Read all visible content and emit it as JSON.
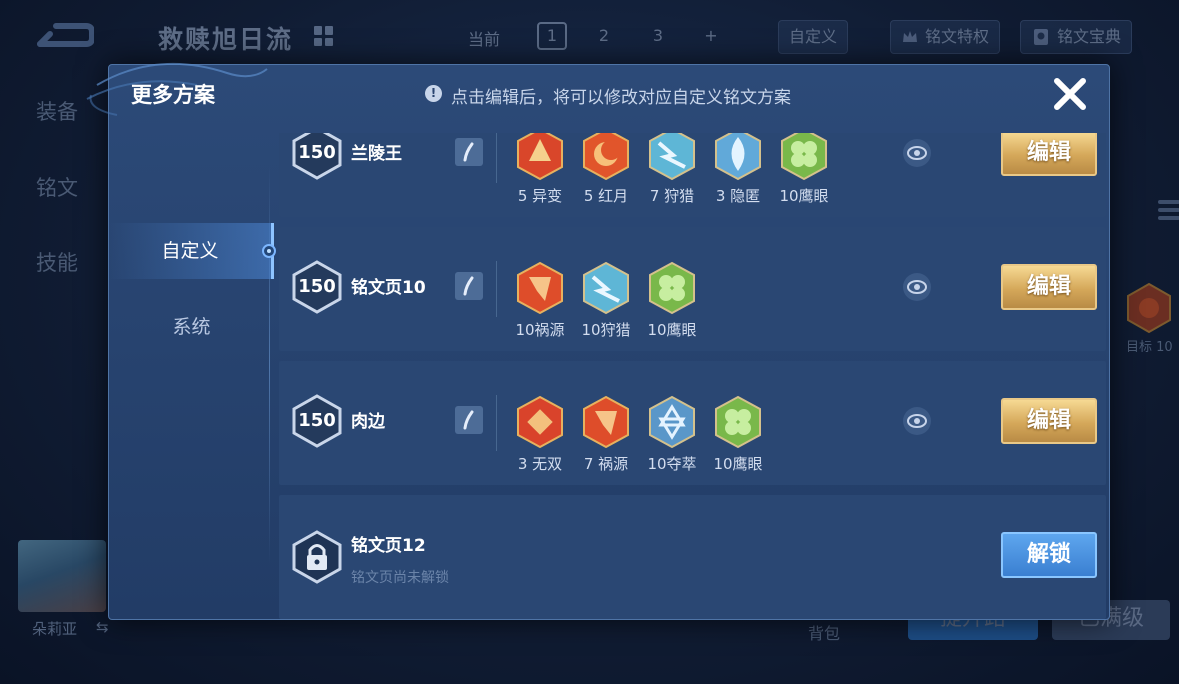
{
  "background": {
    "hero_title": "救赎旭日流",
    "current_label": "当前",
    "pages": [
      "1",
      "2",
      "3",
      "+"
    ],
    "custom_button": "自定义",
    "privilege_button": "铭文特权",
    "codex_button": "铭文宝典",
    "side_nav": [
      "装备",
      "铭文",
      "技能"
    ],
    "side_rune_label": "目标 10",
    "hero_name": "朵莉亚",
    "bag_label": "背包",
    "bottom_buttons": [
      "提升路",
      "已满级"
    ]
  },
  "modal": {
    "title": "更多方案",
    "hint": "点击编辑后，将可以修改对应自定义铭文方案",
    "tabs": [
      "自定义",
      "系统"
    ],
    "rows": [
      {
        "level": "150",
        "name": "兰陵王",
        "runes": [
          {
            "label": "5 异变",
            "color": "#d9462a"
          },
          {
            "label": "5 红月",
            "color": "#e1552b"
          },
          {
            "label": "7 狩猎",
            "color": "#5eb6d6"
          },
          {
            "label": "3 隐匿",
            "color": "#61a9d9"
          },
          {
            "label": "10鹰眼",
            "color": "#79b84a"
          }
        ],
        "action": "编辑"
      },
      {
        "level": "150",
        "name": "铭文页10",
        "runes": [
          {
            "label": "10祸源",
            "color": "#de4d2a"
          },
          {
            "label": "10狩猎",
            "color": "#5eb6d6"
          },
          {
            "label": "10鹰眼",
            "color": "#79b84a"
          }
        ],
        "action": "编辑"
      },
      {
        "level": "150",
        "name": "肉边",
        "runes": [
          {
            "label": "3 无双",
            "color": "#d9432b"
          },
          {
            "label": "7 祸源",
            "color": "#de4d2a"
          },
          {
            "label": "10夺萃",
            "color": "#5a97c9"
          },
          {
            "label": "10鹰眼",
            "color": "#79b84a"
          }
        ],
        "action": "编辑"
      }
    ],
    "locked_row": {
      "name": "铭文页12",
      "subtitle": "铭文页尚未解锁",
      "action": "解锁"
    }
  }
}
